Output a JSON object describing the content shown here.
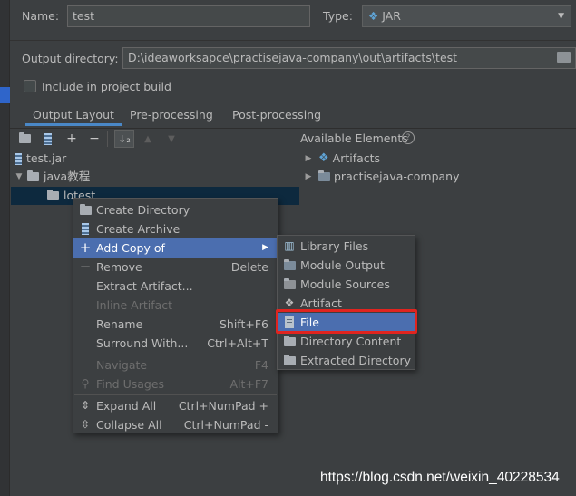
{
  "form": {
    "name_label": "Name:",
    "name_value": "test",
    "type_label": "Type:",
    "type_value": "JAR",
    "output_dir_label": "Output directory:",
    "output_dir_value": "D:\\ideaworksapce\\practisejava-company\\out\\artifacts\\test",
    "include_label": "Include in project build"
  },
  "tabs": [
    "Output Layout",
    "Pre-processing",
    "Post-processing"
  ],
  "available_label": "Available Elements",
  "tree": {
    "root": "test.jar",
    "folder": "java教程",
    "child": "lotest"
  },
  "available_tree": [
    "Artifacts",
    "practisejava-company"
  ],
  "context_menu": {
    "items": [
      {
        "label": "Create Directory",
        "shortcut": "",
        "icon": "create-directory-icon"
      },
      {
        "label": "Create Archive",
        "shortcut": "",
        "icon": "archive-icon"
      },
      {
        "label": "Add Copy of",
        "shortcut": "",
        "icon": "plus-icon"
      },
      {
        "label": "Remove",
        "shortcut": "Delete",
        "icon": "minus-icon"
      },
      {
        "label": "Extract Artifact...",
        "shortcut": "",
        "icon": ""
      },
      {
        "label": "Inline Artifact",
        "shortcut": "",
        "icon": ""
      },
      {
        "label": "Rename",
        "shortcut": "Shift+F6",
        "icon": ""
      },
      {
        "label": "Surround With...",
        "shortcut": "Ctrl+Alt+T",
        "icon": ""
      },
      {
        "label": "Navigate",
        "shortcut": "F4",
        "icon": ""
      },
      {
        "label": "Find Usages",
        "shortcut": "Alt+F7",
        "icon": "search-icon"
      },
      {
        "label": "Expand All",
        "shortcut": "Ctrl+NumPad +",
        "icon": "expand-all-icon"
      },
      {
        "label": "Collapse All",
        "shortcut": "Ctrl+NumPad -",
        "icon": "collapse-all-icon"
      }
    ]
  },
  "submenu": {
    "items": [
      {
        "label": "Library Files",
        "icon": "library-icon"
      },
      {
        "label": "Module Output",
        "icon": "module-output-icon"
      },
      {
        "label": "Module Sources",
        "icon": "module-sources-icon"
      },
      {
        "label": "Artifact",
        "icon": "artifact-icon"
      },
      {
        "label": "File",
        "icon": "file-icon"
      },
      {
        "label": "Directory Content",
        "icon": "folder-icon"
      },
      {
        "label": "Extracted Directory",
        "icon": "extracted-directory-icon"
      }
    ]
  },
  "colors": {
    "background": "#3c3f41",
    "selection": "#4b6eaf",
    "highlight_box": "#e0241f"
  },
  "watermark": "https://blog.csdn.net/weixin_40228534"
}
